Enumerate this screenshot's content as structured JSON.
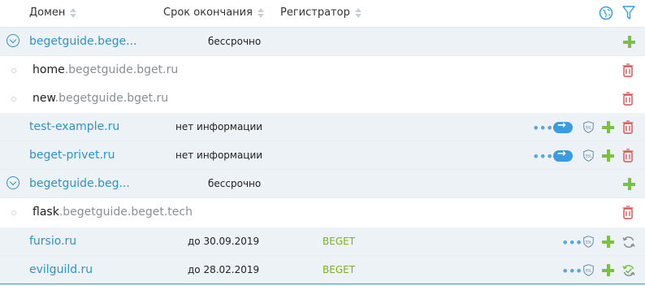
{
  "header": {
    "col_domain": "Домен",
    "col_expiry": "Срок окончания",
    "col_registrar": "Регистратор",
    "globe_icon": "globe-icon",
    "filter_icon": "filter-icon"
  },
  "rows": [
    {
      "type": "group",
      "domain": "begetguide.bege...",
      "expiry": "бессрочно"
    },
    {
      "type": "sub",
      "prefix": "home",
      "rest": ".begetguide.bget.ru"
    },
    {
      "type": "sub",
      "prefix": "new",
      "rest": ".begetguide.bget.ru"
    },
    {
      "type": "domain",
      "domain": "test-example.ru",
      "expiry": "нет информации"
    },
    {
      "type": "domain",
      "domain": "beget-privet.ru",
      "expiry": "нет информации"
    },
    {
      "type": "group",
      "domain": "begetguide.beg...",
      "expiry": "бессрочно"
    },
    {
      "type": "sub",
      "prefix": "flask",
      "rest": ".begetguide.beget.tech"
    },
    {
      "type": "domain",
      "domain": "fursio.ru",
      "expiry": "до 30.09.2019",
      "registrar": "BEGET"
    },
    {
      "type": "domain",
      "domain": "evilguild.ru",
      "expiry": "до 28.02.2019",
      "registrar": "BEGET"
    }
  ],
  "icons": {
    "ssl_label": "SSL",
    "more_label": "•••"
  },
  "colors": {
    "accent": "#2f92cc",
    "add": "#7ac142",
    "delete": "#d9534f",
    "registrar": "#7ab021",
    "row_bg": "#edf2f6"
  }
}
